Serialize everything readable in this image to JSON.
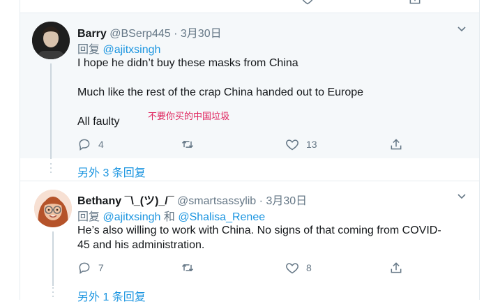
{
  "tweets": [
    {
      "name": "Barry",
      "handle": "@BSerp445",
      "sep": "·",
      "date": "3月30日",
      "reply_prefix": "回复",
      "reply_to_1": "@ajitxsingh",
      "reply_and": "",
      "reply_to_2": "",
      "lines": [
        "I hope he didn’t buy these masks from China",
        "Much like the rest of the crap China handed out to Europe",
        "All faulty"
      ],
      "annotation": "不要你买的中国垃圾",
      "replies": "4",
      "retweets": "",
      "likes": "13",
      "more_replies": "另外 3 条回复"
    },
    {
      "name": "Bethany ¯\\_(ツ)_/¯",
      "handle": "@smartsassylib",
      "sep": "·",
      "date": "3月30日",
      "reply_prefix": "回复",
      "reply_to_1": "@ajitxsingh",
      "reply_and": "和",
      "reply_to_2": "@Shalisa_Renee",
      "lines": [
        "He’s also willing to work with China.  No signs of that coming from COVID-",
        "45 and his administration."
      ],
      "replies": "7",
      "retweets": "",
      "likes": "8",
      "more_replies": "另外 1 条回复"
    }
  ],
  "colors": {
    "link": "#1b95e0",
    "muted": "#657786",
    "annotation": "#e0245e",
    "highlight_bg": "#f5f8fa"
  },
  "icons": [
    "reply-icon",
    "retweet-icon",
    "like-icon",
    "share-icon",
    "chevron-down-icon"
  ]
}
